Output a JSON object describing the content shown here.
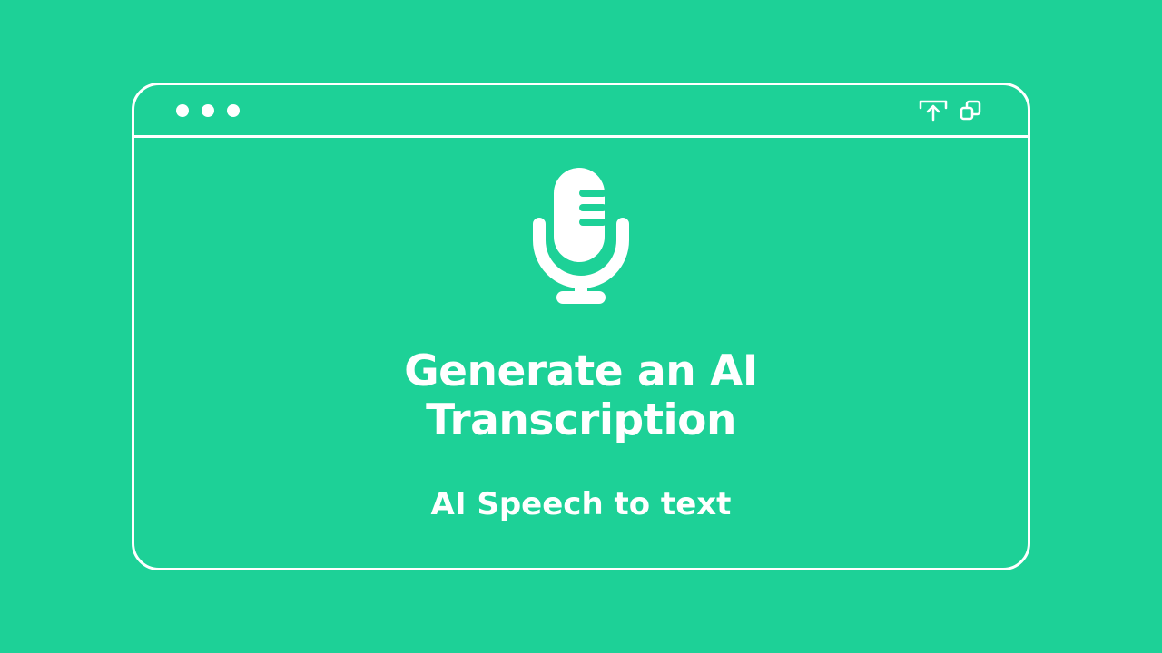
{
  "colors": {
    "background": "#1dd197",
    "foreground": "#ffffff"
  },
  "window": {
    "titlebar_dots": 3,
    "controls": [
      "share-upload-icon",
      "restore-window-icon"
    ]
  },
  "hero": {
    "icon": "microphone-icon",
    "title_line1": "Generate an AI",
    "title_line2": "Transcription",
    "subtitle": "AI Speech to text"
  }
}
